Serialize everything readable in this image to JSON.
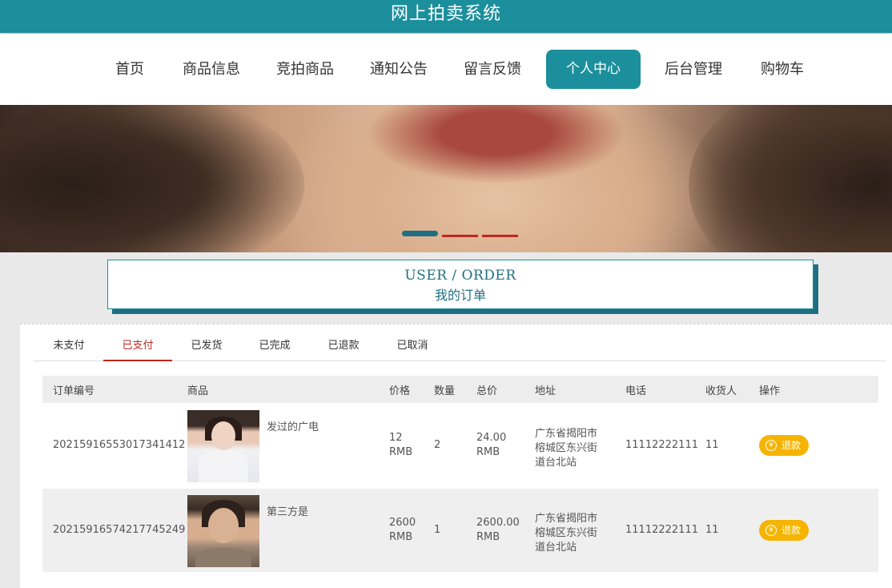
{
  "header": {
    "title": "网上拍卖系统"
  },
  "nav": {
    "items": [
      {
        "label": "首页"
      },
      {
        "label": "商品信息"
      },
      {
        "label": "竞拍商品"
      },
      {
        "label": "通知公告"
      },
      {
        "label": "留言反馈"
      },
      {
        "label": "个人中心",
        "active": true
      },
      {
        "label": "后台管理"
      },
      {
        "label": "购物车"
      }
    ],
    "accent_color": "#1c8f9c"
  },
  "banner": {
    "dots": 3,
    "active_dot": 1
  },
  "page_head": {
    "en": "USER / ORDER",
    "cn": "我的订单"
  },
  "tabs": [
    {
      "label": "未支付"
    },
    {
      "label": "已支付",
      "active": true
    },
    {
      "label": "已发货"
    },
    {
      "label": "已完成"
    },
    {
      "label": "已退款"
    },
    {
      "label": "已取消"
    }
  ],
  "table": {
    "headers": [
      "订单编号",
      "商品",
      "价格",
      "数量",
      "总价",
      "地址",
      "电话",
      "收货人",
      "操作"
    ],
    "rows": [
      {
        "order_no": "20215916553017341412",
        "product": "发过的广电",
        "price": "12",
        "price_unit": "RMB",
        "qty": "2",
        "total": "24.00",
        "total_unit": "RMB",
        "address_l1": "广东省揭阳市",
        "address_l2": "榕城区东兴街",
        "address_l3": "道台北站",
        "phone": "11112222111",
        "receiver": "11",
        "action": "退款"
      },
      {
        "order_no": "20215916574217745249",
        "product": "第三方是",
        "price": "2600",
        "price_unit": "RMB",
        "qty": "1",
        "total": "2600.00",
        "total_unit": "RMB",
        "address_l1": "广东省揭阳市",
        "address_l2": "榕城区东兴街",
        "address_l3": "道台北站",
        "phone": "11112222111",
        "receiver": "11",
        "action": "退款"
      }
    ],
    "action_icon": "yen-icon",
    "action_color": "#f5b400"
  }
}
